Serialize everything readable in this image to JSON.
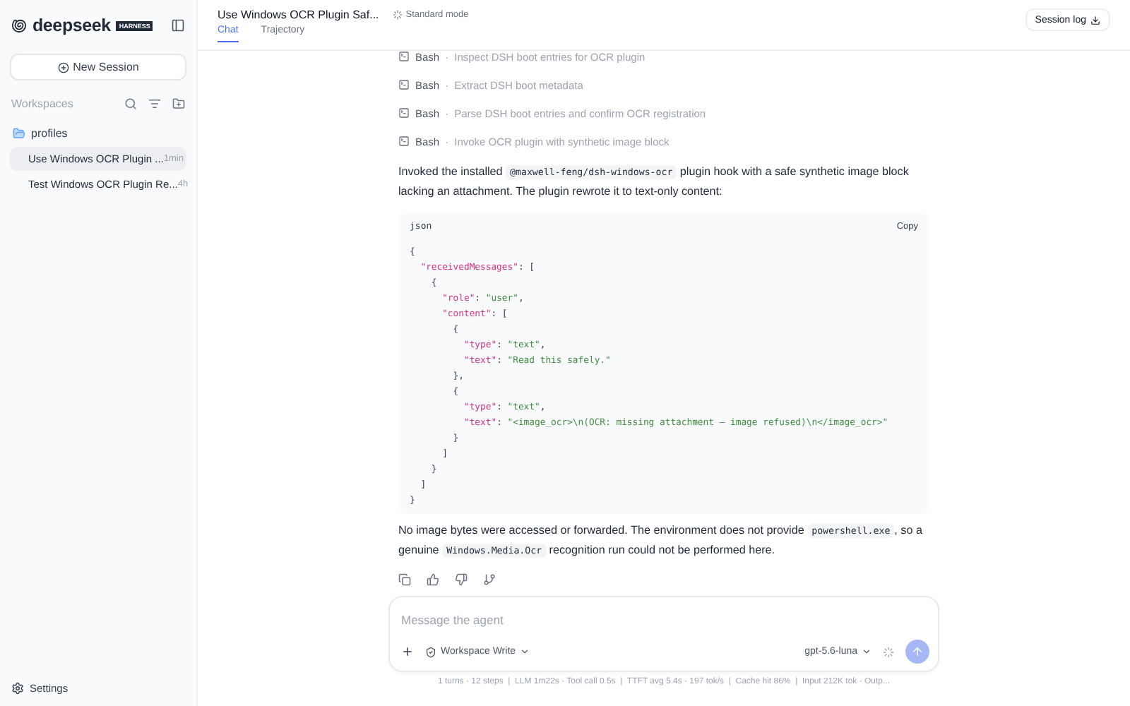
{
  "sidebar": {
    "brand": "deepseek",
    "brand_badge": "HARNESS",
    "new_session": "New Session",
    "workspaces_label": "Workspaces",
    "folder": {
      "name": "profiles",
      "expanded": true,
      "sessions": [
        {
          "title": "Use Windows OCR Plugin ...",
          "age": "1min",
          "selected": true
        },
        {
          "title": "Test Windows OCR Plugin Re...",
          "age": "4h",
          "selected": false
        }
      ]
    },
    "settings": "Settings"
  },
  "header": {
    "title": "Use Windows OCR Plugin Saf...",
    "mode": "Standard mode",
    "session_log": "Session log",
    "tabs": [
      {
        "label": "Chat",
        "selected": true
      },
      {
        "label": "Trajectory",
        "selected": false
      }
    ]
  },
  "tool_calls": [
    {
      "tool": "Bash",
      "separator": "·",
      "description": "Inspect DSH boot entries for OCR plugin"
    },
    {
      "tool": "Bash",
      "separator": "·",
      "description": "Extract DSH boot metadata"
    },
    {
      "tool": "Bash",
      "separator": "·",
      "description": "Parse DSH boot entries and confirm OCR registration"
    },
    {
      "tool": "Bash",
      "separator": "·",
      "description": "Invoke OCR plugin with synthetic image block"
    }
  ],
  "intro": [
    {
      "kind": "text",
      "text": "Invoked the installed "
    },
    {
      "kind": "code",
      "text": "@maxwell-feng/dsh-windows-ocr"
    },
    {
      "kind": "text",
      "text": " plugin hook with a safe synthetic image block lacking an attachment. The plugin rewrote it to text-only content:"
    }
  ],
  "code_block": {
    "language": "json",
    "copy": "Copy",
    "lines": [
      [
        {
          "kind": "punct",
          "text": "{"
        }
      ],
      [
        {
          "kind": "key",
          "text": "  \"receivedMessages\""
        },
        {
          "kind": "punct",
          "text": ": ["
        }
      ],
      [
        {
          "kind": "punct",
          "text": "    {"
        }
      ],
      [
        {
          "kind": "key",
          "text": "      \"role\""
        },
        {
          "kind": "punct",
          "text": ": "
        },
        {
          "kind": "string",
          "text": "\"user\""
        },
        {
          "kind": "punct",
          "text": ","
        }
      ],
      [
        {
          "kind": "key",
          "text": "      \"content\""
        },
        {
          "kind": "punct",
          "text": ": ["
        }
      ],
      [
        {
          "kind": "punct",
          "text": "        {"
        }
      ],
      [
        {
          "kind": "key",
          "text": "          \"type\""
        },
        {
          "kind": "punct",
          "text": ": "
        },
        {
          "kind": "string",
          "text": "\"text\""
        },
        {
          "kind": "punct",
          "text": ","
        }
      ],
      [
        {
          "kind": "key",
          "text": "          \"text\""
        },
        {
          "kind": "punct",
          "text": ": "
        },
        {
          "kind": "string",
          "text": "\"Read this safely.\""
        }
      ],
      [
        {
          "kind": "punct",
          "text": "        },"
        }
      ],
      [
        {
          "kind": "punct",
          "text": "        {"
        }
      ],
      [
        {
          "kind": "key",
          "text": "          \"type\""
        },
        {
          "kind": "punct",
          "text": ": "
        },
        {
          "kind": "string",
          "text": "\"text\""
        },
        {
          "kind": "punct",
          "text": ","
        }
      ],
      [
        {
          "kind": "key",
          "text": "          \"text\""
        },
        {
          "kind": "punct",
          "text": ": "
        },
        {
          "kind": "string",
          "text": "\"<image_ocr>\\n(OCR: missing attachment — image refused)\\n</image_ocr>\""
        }
      ],
      [
        {
          "kind": "punct",
          "text": "        }"
        }
      ],
      [
        {
          "kind": "punct",
          "text": "      ]"
        }
      ],
      [
        {
          "kind": "punct",
          "text": "    }"
        }
      ],
      [
        {
          "kind": "punct",
          "text": "  ]"
        }
      ],
      [
        {
          "kind": "punct",
          "text": "}"
        }
      ]
    ]
  },
  "outro": [
    {
      "kind": "text",
      "text": "No image bytes were accessed or forwarded. The environment does not provide "
    },
    {
      "kind": "code",
      "text": "powershell.exe"
    },
    {
      "kind": "text",
      "text": ", so a genuine "
    },
    {
      "kind": "code",
      "text": "Windows.Media.Ocr"
    },
    {
      "kind": "text",
      "text": " recognition run could not be performed here."
    }
  ],
  "composer": {
    "placeholder": "Message the agent",
    "permission": "Workspace Write",
    "model": "gpt-5.6-luna"
  },
  "status_bar": "1 turns · 12 steps  |  LLM 1m22s · Tool call 0.5s  |  TTFT avg 5.4s · 197 tok/s  |  Cache hit 86%  |  Input 212K tok · Outp..."
}
